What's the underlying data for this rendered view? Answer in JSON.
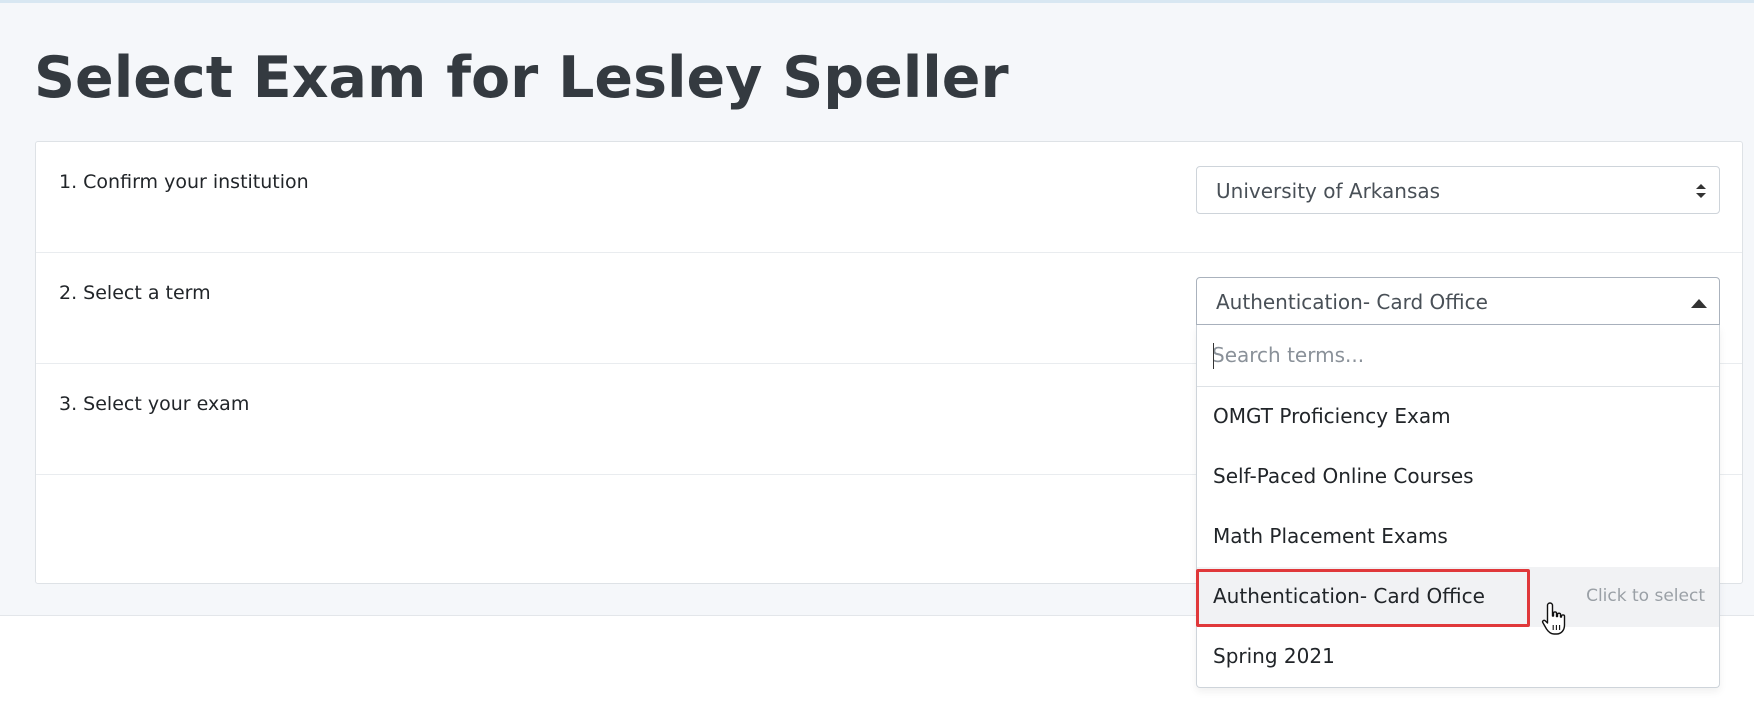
{
  "page": {
    "title": "Select Exam for Lesley Speller"
  },
  "steps": [
    {
      "label": "1. Confirm your institution",
      "value": "University of Arkansas"
    },
    {
      "label": "2. Select a term",
      "value": "Authentication- Card Office"
    },
    {
      "label": "3. Select your exam"
    }
  ],
  "dropdown": {
    "search_placeholder": "Search terms...",
    "options": [
      {
        "label": "OMGT Proficiency Exam"
      },
      {
        "label": "Self-Paced Online Courses"
      },
      {
        "label": "Math Placement Exams"
      },
      {
        "label": "Authentication- Card Office",
        "hint": "Click to select"
      },
      {
        "label": "Spring 2021"
      }
    ]
  },
  "colors": {
    "highlight": "#e0383a",
    "accent": "#0f6fc1",
    "title": "#343a40"
  }
}
